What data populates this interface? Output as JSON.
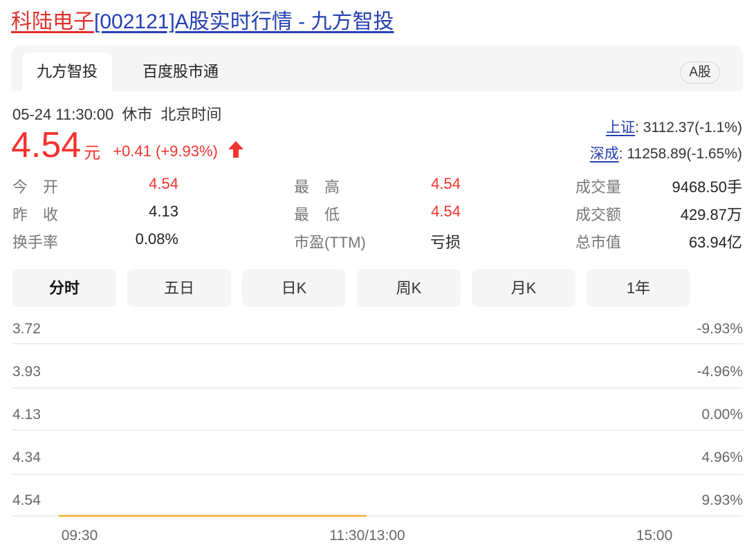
{
  "header": {
    "title_name": "科陆电子",
    "title_rest": "[002121]A股实时行情 - 九方智投"
  },
  "tabs": {
    "items": [
      "九方智投",
      "百度股市通"
    ],
    "badge": "A股"
  },
  "status": {
    "datetime": "05-24 11:30:00",
    "market_state": "休市",
    "timezone": "北京时间"
  },
  "quote": {
    "price": "4.54",
    "unit": "元",
    "change": "+0.41 (+9.93%)",
    "up_color": "#f4322e",
    "direction_icon": "arrow-up-icon"
  },
  "indices": [
    {
      "name": "上证",
      "value": ": 3112.37(-1.1%)"
    },
    {
      "name": "深成",
      "value": ": 11258.89(-1.65%)"
    }
  ],
  "stats": {
    "open_label": "今　开",
    "open_value": "4.54",
    "prev_close_label": "昨　收",
    "prev_close_value": "4.13",
    "turnover_label": "换手率",
    "turnover_value": "0.08%",
    "high_label": "最　高",
    "high_value": "4.54",
    "low_label": "最　低",
    "low_value": "4.54",
    "pe_label": "市盈(TTM)",
    "pe_value": "亏损",
    "volume_label": "成交量",
    "volume_value": "9468.50手",
    "amount_label": "成交额",
    "amount_value": "429.87万",
    "mktcap_label": "总市值",
    "mktcap_value": "63.94亿"
  },
  "period_tabs": [
    "分时",
    "五日",
    "日K",
    "周K",
    "月K",
    "1年"
  ],
  "chart_data": {
    "type": "line",
    "y_ticks_price": [
      "3.72",
      "3.93",
      "4.13",
      "4.34",
      "4.54"
    ],
    "y_ticks_pct": [
      "-9.93%",
      "-4.96%",
      "0.00%",
      "4.96%",
      "9.93%"
    ],
    "x_ticks": [
      "09:30",
      "11:30/13:00",
      "15:00"
    ],
    "series": [
      {
        "values": [
          [
            0,
            4.54
          ],
          [
            120,
            4.54
          ]
        ],
        "color": "#f0b02c"
      }
    ],
    "x_range_minutes": [
      0,
      240
    ],
    "grid": true
  }
}
